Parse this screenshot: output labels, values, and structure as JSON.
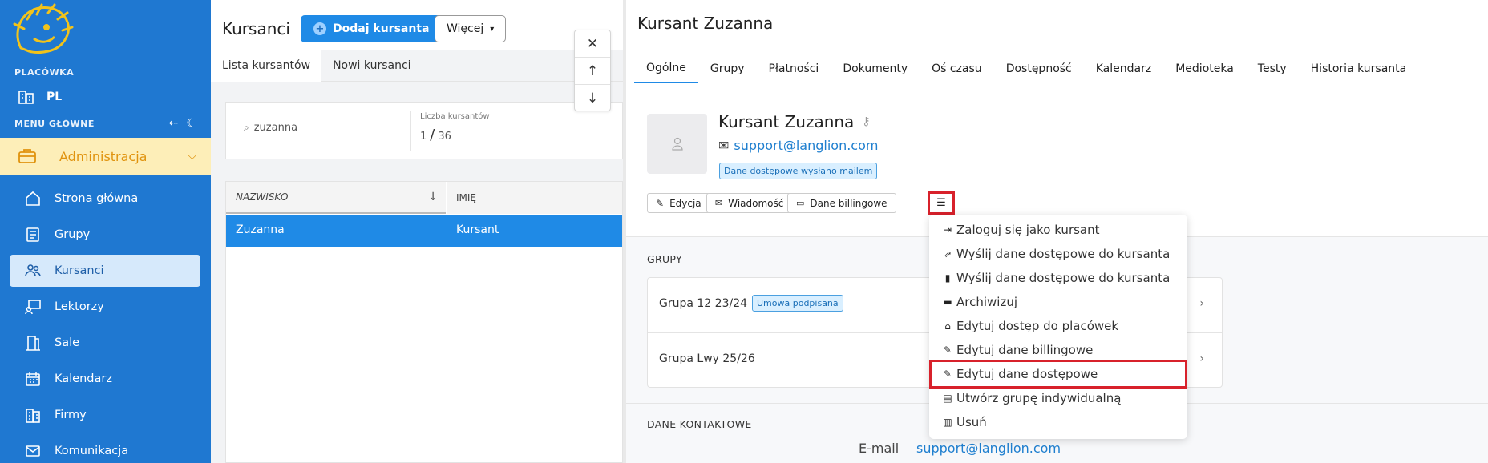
{
  "sidebar": {
    "placowka_label": "PLACÓWKA",
    "placowka_value": "PL",
    "menu_label": "MENU GŁÓWNE",
    "admin_label": "Administracja",
    "items": [
      {
        "label": "Strona główna"
      },
      {
        "label": "Grupy"
      },
      {
        "label": "Kursanci"
      },
      {
        "label": "Lektorzy"
      },
      {
        "label": "Sale"
      },
      {
        "label": "Kalendarz"
      },
      {
        "label": "Firmy"
      },
      {
        "label": "Komunikacja"
      }
    ]
  },
  "list": {
    "title": "Kursanci",
    "add_button": "Dodaj kursanta",
    "more_button": "Więcej",
    "tabs": [
      {
        "label": "Lista kursantów"
      },
      {
        "label": "Nowi kursanci"
      }
    ],
    "search_value": "zuzanna",
    "count_label": "Liczba kursantów",
    "count_current": "1",
    "count_total": "36",
    "columns": [
      "NAZWISKO",
      "IMIĘ"
    ],
    "rows": [
      {
        "surname": "Zuzanna",
        "name": "Kursant"
      }
    ]
  },
  "detail": {
    "title": "Kursant Zuzanna",
    "tabs": [
      {
        "label": "Ogólne"
      },
      {
        "label": "Grupy"
      },
      {
        "label": "Płatności"
      },
      {
        "label": "Dokumenty"
      },
      {
        "label": "Oś czasu"
      },
      {
        "label": "Dostępność"
      },
      {
        "label": "Kalendarz"
      },
      {
        "label": "Medioteka"
      },
      {
        "label": "Testy"
      },
      {
        "label": "Historia kursanta"
      }
    ],
    "name": "Kursant Zuzanna",
    "email": "support@langlion.com",
    "badge": "Dane dostępowe wysłano mailem",
    "actions": {
      "edit": "Edycja",
      "message": "Wiadomość",
      "billing": "Dane billingowe"
    },
    "groups_title": "GRUPY",
    "groups": [
      {
        "name": "Grupa 12 23/24",
        "badge": "Umowa podpisana"
      },
      {
        "name": "Grupa Lwy 25/26"
      }
    ],
    "contact_title": "DANE KONTAKTOWE",
    "contact_email_label": "E-mail",
    "contact_email": "support@langlion.com"
  },
  "dropdown": {
    "items": [
      {
        "label": "Zaloguj się jako kursant",
        "icon": "sign-in-icon"
      },
      {
        "label": "Wyślij dane dostępowe do kursanta",
        "icon": "share-icon"
      },
      {
        "label": "Wyślij dane dostępowe do kursanta",
        "icon": "mobile-icon"
      },
      {
        "label": "Archiwizuj",
        "icon": "folder-icon"
      },
      {
        "label": "Edytuj dostęp do placówek",
        "icon": "home-icon"
      },
      {
        "label": "Edytuj dane billingowe",
        "icon": "edit-icon"
      },
      {
        "label": "Edytuj dane dostępowe",
        "icon": "edit-icon"
      },
      {
        "label": "Utwórz grupę indywidualną",
        "icon": "book-icon"
      },
      {
        "label": "Usuń",
        "icon": "trash-icon"
      }
    ]
  },
  "colors": {
    "sidebar": "#1f78d1",
    "accent": "#1f8ae6",
    "highlight": "#d8212b",
    "admin_bg": "#fdeeb8"
  }
}
